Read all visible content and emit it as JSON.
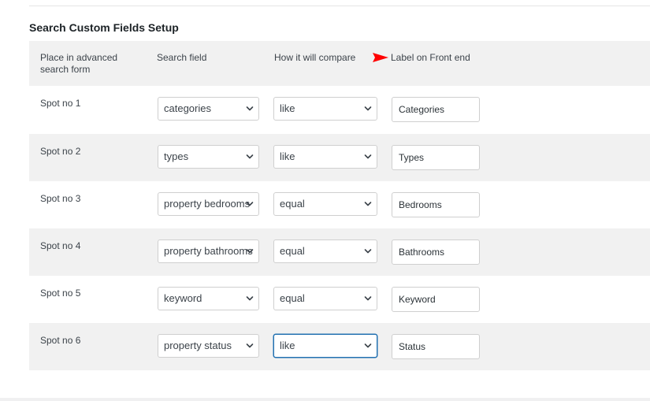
{
  "section": {
    "title": "Search Custom Fields Setup"
  },
  "table": {
    "headers": {
      "place": "Place in advanced search form",
      "field": "Search field",
      "compare": "How it will compare",
      "label": "Label on Front end"
    },
    "rows": [
      {
        "spot": "Spot no 1",
        "field": "categories",
        "compare": "like",
        "label": "Categories"
      },
      {
        "spot": "Spot no 2",
        "field": "types",
        "compare": "like",
        "label": "Types"
      },
      {
        "spot": "Spot no 3",
        "field": "property bedrooms",
        "compare": "equal",
        "label": "Bedrooms"
      },
      {
        "spot": "Spot no 4",
        "field": "property bathrooms",
        "compare": "equal",
        "label": "Bathrooms"
      },
      {
        "spot": "Spot no 5",
        "field": "keyword",
        "compare": "equal",
        "label": "Keyword"
      },
      {
        "spot": "Spot no 6",
        "field": "property status",
        "compare": "like",
        "label": "Status"
      }
    ]
  },
  "icons": {
    "header_marker": "red-flag-icon",
    "select_arrow": "chevron-down-icon"
  },
  "colors": {
    "accent_focus": "#2271b1",
    "row_shade": "#f1f1f1",
    "flag": "#ff0000"
  }
}
